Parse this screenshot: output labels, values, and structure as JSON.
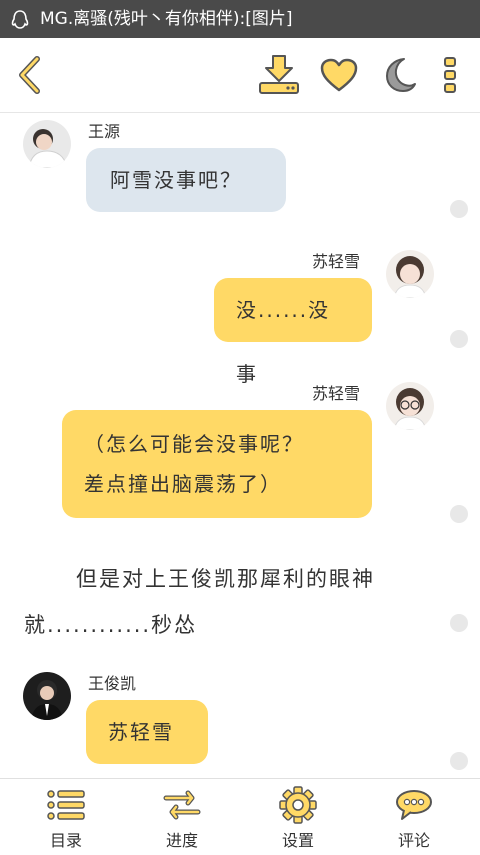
{
  "status_bar": {
    "title": "MG.离骚(残叶丶有你相伴):[图片]"
  },
  "toolbar": {
    "back_icon": "chevron-left-icon",
    "download_icon": "download-icon",
    "favorite_icon": "heart-icon",
    "night_mode_icon": "moon-icon",
    "more_icon": "more-vertical-icon"
  },
  "messages": [
    {
      "sender": "王源",
      "text": "阿雪没事吧？",
      "side": "left",
      "bubble_color": "#dde6ee"
    },
    {
      "sender": "苏轻雪",
      "text": "没......没事",
      "side": "right",
      "bubble_color": "#ffd966"
    },
    {
      "sender": "苏轻雪",
      "line1": "（怎么可能会没事呢？",
      "line2": "差点撞出脑震荡了）",
      "side": "right",
      "bubble_color": "#ffd966"
    },
    {
      "sender": "王俊凯",
      "text": "苏轻雪",
      "side": "left",
      "bubble_color": "#ffd966"
    }
  ],
  "narration": {
    "line1": "但是对上王俊凯那犀利的眼神",
    "line2": "就............秒怂"
  },
  "bottom_nav": [
    {
      "label": "目录",
      "icon": "list-icon"
    },
    {
      "label": "进度",
      "icon": "swap-arrows-icon"
    },
    {
      "label": "设置",
      "icon": "gear-icon"
    },
    {
      "label": "评论",
      "icon": "comment-bubble-icon"
    }
  ],
  "colors": {
    "accent": "#ffd966",
    "icon_stroke": "#555555",
    "status_bar": "#4a4a4a"
  }
}
